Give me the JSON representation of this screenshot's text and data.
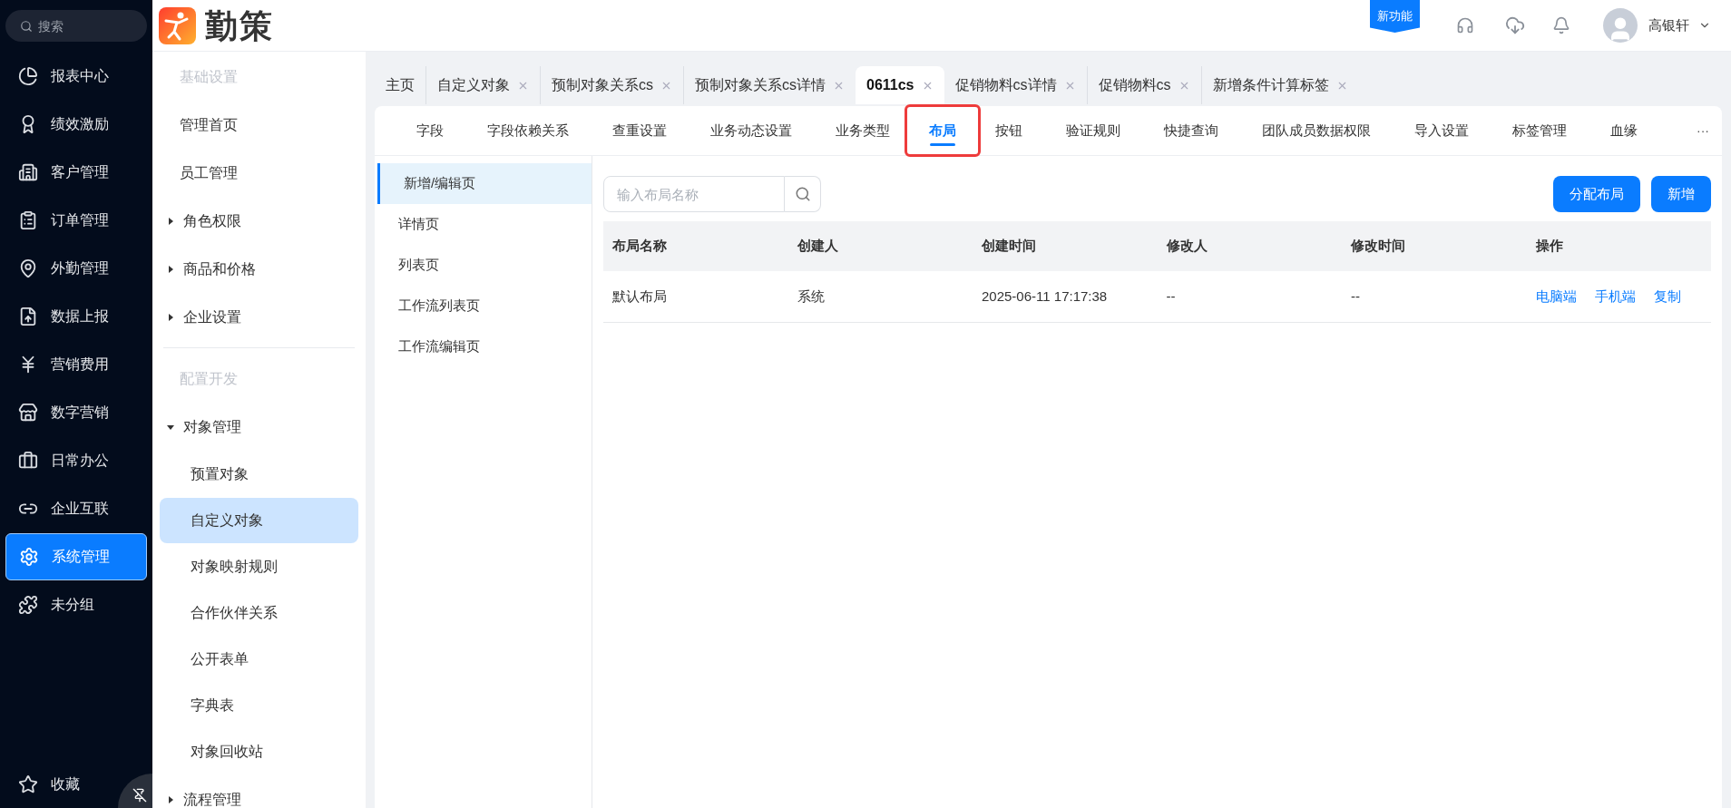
{
  "search": {
    "placeholder": "搜索"
  },
  "nav": [
    {
      "label": "报表中心",
      "selected": false
    },
    {
      "label": "绩效激励",
      "selected": false
    },
    {
      "label": "客户管理",
      "selected": false
    },
    {
      "label": "订单管理",
      "selected": false
    },
    {
      "label": "外勤管理",
      "selected": false
    },
    {
      "label": "数据上报",
      "selected": false
    },
    {
      "label": "营销费用",
      "selected": false
    },
    {
      "label": "数字营销",
      "selected": false
    },
    {
      "label": "日常办公",
      "selected": false
    },
    {
      "label": "企业互联",
      "selected": false
    },
    {
      "label": "系统管理",
      "selected": true
    },
    {
      "label": "未分组",
      "selected": false
    }
  ],
  "favorites": "收藏",
  "logo": "勤策",
  "new_feature": "新功能",
  "user": "高银轩",
  "menu": [
    {
      "kind": "heading",
      "label": "基础设置"
    },
    {
      "kind": "item",
      "label": "管理首页"
    },
    {
      "kind": "item",
      "label": "员工管理"
    },
    {
      "kind": "group",
      "label": "角色权限",
      "expanded": false
    },
    {
      "kind": "group",
      "label": "商品和价格",
      "expanded": false
    },
    {
      "kind": "group",
      "label": "企业设置",
      "expanded": false
    },
    {
      "kind": "divider"
    },
    {
      "kind": "heading",
      "label": "配置开发"
    },
    {
      "kind": "group",
      "label": "对象管理",
      "expanded": true,
      "children": [
        {
          "label": "预置对象",
          "selected": false
        },
        {
          "label": "自定义对象",
          "selected": true
        },
        {
          "label": "对象映射规则",
          "selected": false
        },
        {
          "label": "合作伙伴关系",
          "selected": false
        },
        {
          "label": "公开表单",
          "selected": false
        },
        {
          "label": "字典表",
          "selected": false
        },
        {
          "label": "对象回收站",
          "selected": false
        }
      ]
    },
    {
      "kind": "group",
      "label": "流程管理",
      "expanded": false
    }
  ],
  "page_tabs": [
    {
      "label": "主页",
      "closable": false,
      "selected": false
    },
    {
      "label": "自定义对象",
      "closable": true,
      "selected": false
    },
    {
      "label": "预制对象关系cs",
      "closable": true,
      "selected": false
    },
    {
      "label": "预制对象关系cs详情",
      "closable": true,
      "selected": false
    },
    {
      "label": "0611cs",
      "closable": true,
      "selected": true
    },
    {
      "label": "促销物料cs详情",
      "closable": true,
      "selected": false
    },
    {
      "label": "促销物料cs",
      "closable": true,
      "selected": false
    },
    {
      "label": "新增条件计算标签",
      "closable": true,
      "selected": false
    }
  ],
  "sub_tabs": [
    {
      "label": "字段",
      "selected": false,
      "highlighted": false
    },
    {
      "label": "字段依赖关系",
      "selected": false,
      "highlighted": false
    },
    {
      "label": "查重设置",
      "selected": false,
      "highlighted": false
    },
    {
      "label": "业务动态设置",
      "selected": false,
      "highlighted": false
    },
    {
      "label": "业务类型",
      "selected": false,
      "highlighted": false
    },
    {
      "label": "布局",
      "selected": true,
      "highlighted": true
    },
    {
      "label": "按钮",
      "selected": false,
      "highlighted": false
    },
    {
      "label": "验证规则",
      "selected": false,
      "highlighted": false
    },
    {
      "label": "快捷查询",
      "selected": false,
      "highlighted": false
    },
    {
      "label": "团队成员数据权限",
      "selected": false,
      "highlighted": false
    },
    {
      "label": "导入设置",
      "selected": false,
      "highlighted": false
    },
    {
      "label": "标签管理",
      "selected": false,
      "highlighted": false
    },
    {
      "label": "血缘",
      "selected": false,
      "highlighted": false
    }
  ],
  "more": "···",
  "layout_types": [
    {
      "label": "新增/编辑页",
      "selected": true
    },
    {
      "label": "详情页",
      "selected": false
    },
    {
      "label": "列表页",
      "selected": false
    },
    {
      "label": "工作流列表页",
      "selected": false
    },
    {
      "label": "工作流编辑页",
      "selected": false
    }
  ],
  "layout_search": {
    "placeholder": "输入布局名称"
  },
  "buttons": [
    "分配布局",
    "新增"
  ],
  "table": {
    "columns": [
      "布局名称",
      "创建人",
      "创建时间",
      "修改人",
      "修改时间",
      "操作"
    ],
    "rows": [
      {
        "cells": [
          "默认布局",
          "系统",
          "2025-06-11 17:17:38",
          "--",
          "--"
        ],
        "actions": [
          "电脑端",
          "手机端",
          "复制"
        ]
      }
    ]
  }
}
